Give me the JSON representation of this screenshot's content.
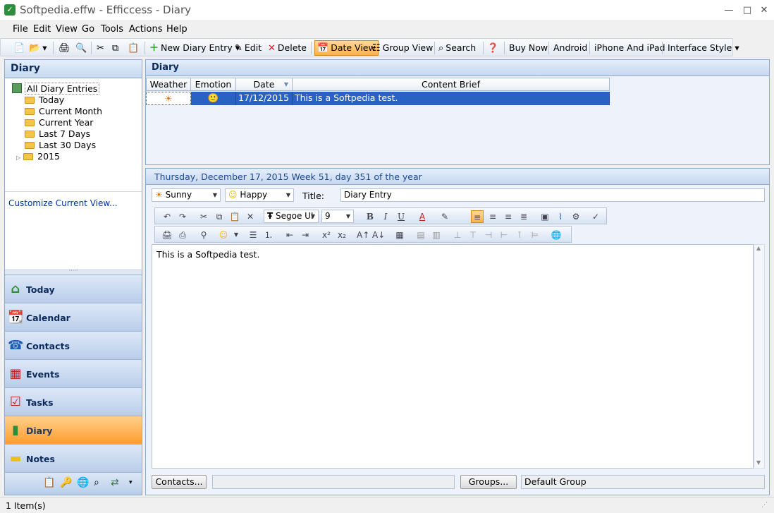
{
  "window": {
    "title": "Softpedia.effw - Efficcess - Diary",
    "app_icon": "check-icon",
    "min": "—",
    "max": "□",
    "close": "✕"
  },
  "menu": [
    "File",
    "Edit",
    "View",
    "Go",
    "Tools",
    "Actions",
    "Help"
  ],
  "toolbar": {
    "new_entry": "New Diary Entry",
    "edit": "Edit",
    "delete": "Delete",
    "date_view": "Date View",
    "group_view": "Group View",
    "search": "Search",
    "buy_now": "Buy Now",
    "android": "Android",
    "iphone": "iPhone And iPad",
    "interface_style": "Interface Style"
  },
  "left": {
    "header": "Diary",
    "tree": {
      "root": "All Diary Entries",
      "items": [
        "Today",
        "Current Month",
        "Current Year",
        "Last 7 Days",
        "Last 30 Days",
        "2015"
      ]
    },
    "customize": "Customize Current View...",
    "nav": [
      "Today",
      "Calendar",
      "Contacts",
      "Events",
      "Tasks",
      "Diary",
      "Notes"
    ]
  },
  "list": {
    "header": "Diary",
    "columns": [
      "Weather",
      "Emotion",
      "Date",
      "Content Brief"
    ],
    "rows": [
      {
        "weather": "☀",
        "emotion": "🙂",
        "date": "17/12/2015",
        "brief": "This is a Softpedia test."
      }
    ]
  },
  "detail": {
    "date_line": "Thursday, December 17, 2015  Week 51, day 351 of the year",
    "weather": "Sunny",
    "emotion": "Happy",
    "title_label": "Title:",
    "title_value": "Diary Entry",
    "font": "Segoe UI",
    "size": "9",
    "body": "This is a Softpedia test.",
    "contacts_btn": "Contacts...",
    "groups_btn": "Groups...",
    "group_value": "Default Group"
  },
  "status": "1 Item(s)",
  "colors": {
    "accent": "#2a62c4",
    "active_nav": "#ff9d2e"
  }
}
